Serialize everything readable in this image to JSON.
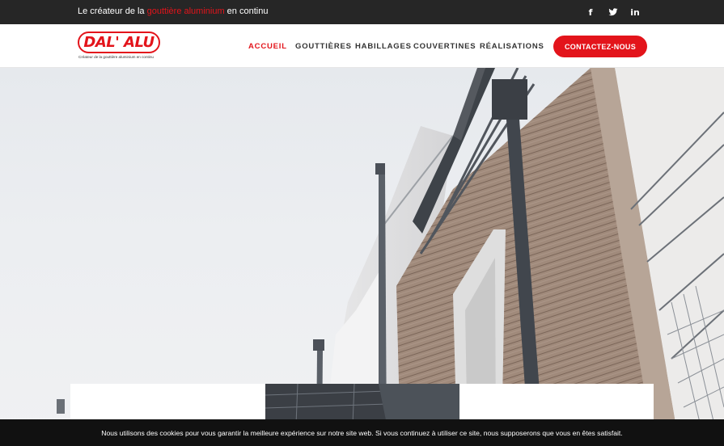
{
  "topbar": {
    "tagline_before": "Le créateur de la ",
    "tagline_highlight": "gouttière aluminium",
    "tagline_after": " en continu",
    "social": [
      {
        "icon": "facebook-icon",
        "glyph": "f"
      },
      {
        "icon": "twitter-icon"
      },
      {
        "icon": "linkedin-icon",
        "glyph": "in"
      }
    ]
  },
  "header": {
    "logo_text": "DAL' ALU",
    "logo_subtitle": "Créateur de la gouttière aluminium en continu",
    "nav": [
      {
        "label": "ACCUEIL",
        "active": true
      },
      {
        "label": "GOUTTIÈRES",
        "active": false
      },
      {
        "label": "HABILLAGES",
        "active": false
      },
      {
        "label": "COUVERTINES",
        "active": false
      },
      {
        "label": "RÉALISATIONS",
        "active": false
      }
    ],
    "cta_label": "CONTACTEZ-NOUS"
  },
  "cookie": {
    "message": "Nous utilisons des cookies pour vous garantir la meilleure expérience sur notre site web. Si vous continuez à utiliser ce site, nous supposerons que vous en êtes satisfait."
  },
  "colors": {
    "brand_red": "#e3141b",
    "topbar_bg": "#262626",
    "cookie_bg": "#111111"
  }
}
